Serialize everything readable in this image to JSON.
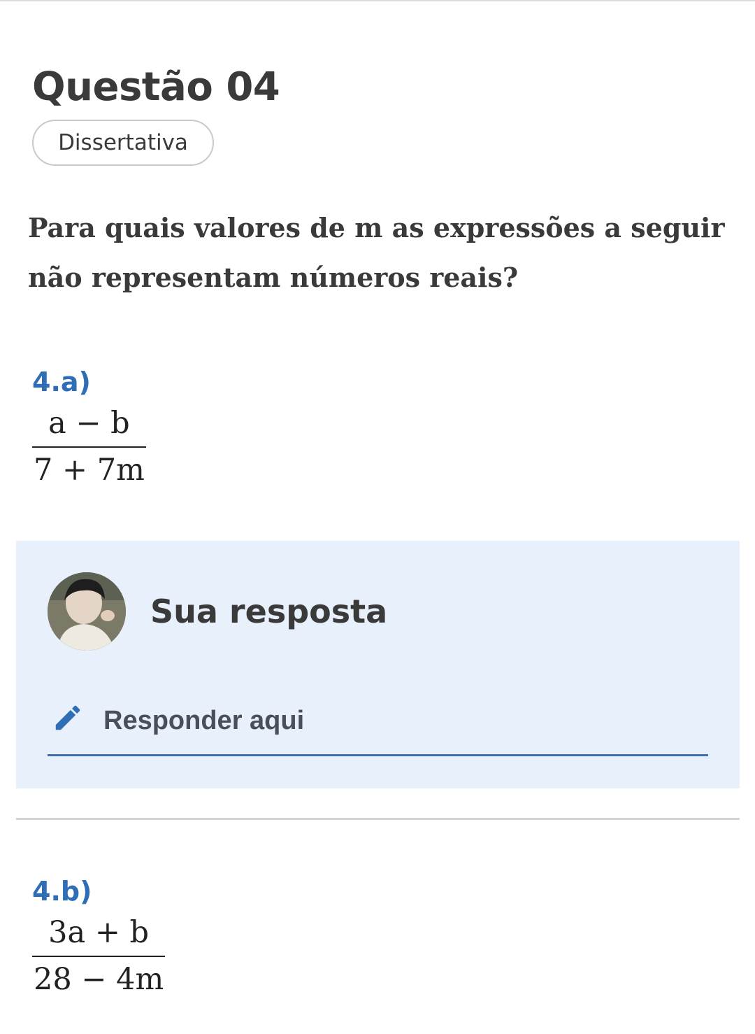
{
  "question": {
    "title": "Questão 04",
    "type_badge": "Dissertativa",
    "statement_line1": "Para quais valores de m as expressões a seguir",
    "statement_line2": "não representam números reais?"
  },
  "parts": [
    {
      "label": "4.a)",
      "numerator": "a − b",
      "denominator": "7 + 7m"
    },
    {
      "label": "4.b)",
      "numerator": "3a + b",
      "denominator": "28 − 4m"
    }
  ],
  "answer": {
    "heading": "Sua resposta",
    "placeholder": "Responder aqui",
    "accent_color": "#2f6db5",
    "panel_color": "#e8f0fc"
  },
  "icons": {
    "avatar": "user-avatar-photo",
    "edit": "pencil-icon"
  }
}
